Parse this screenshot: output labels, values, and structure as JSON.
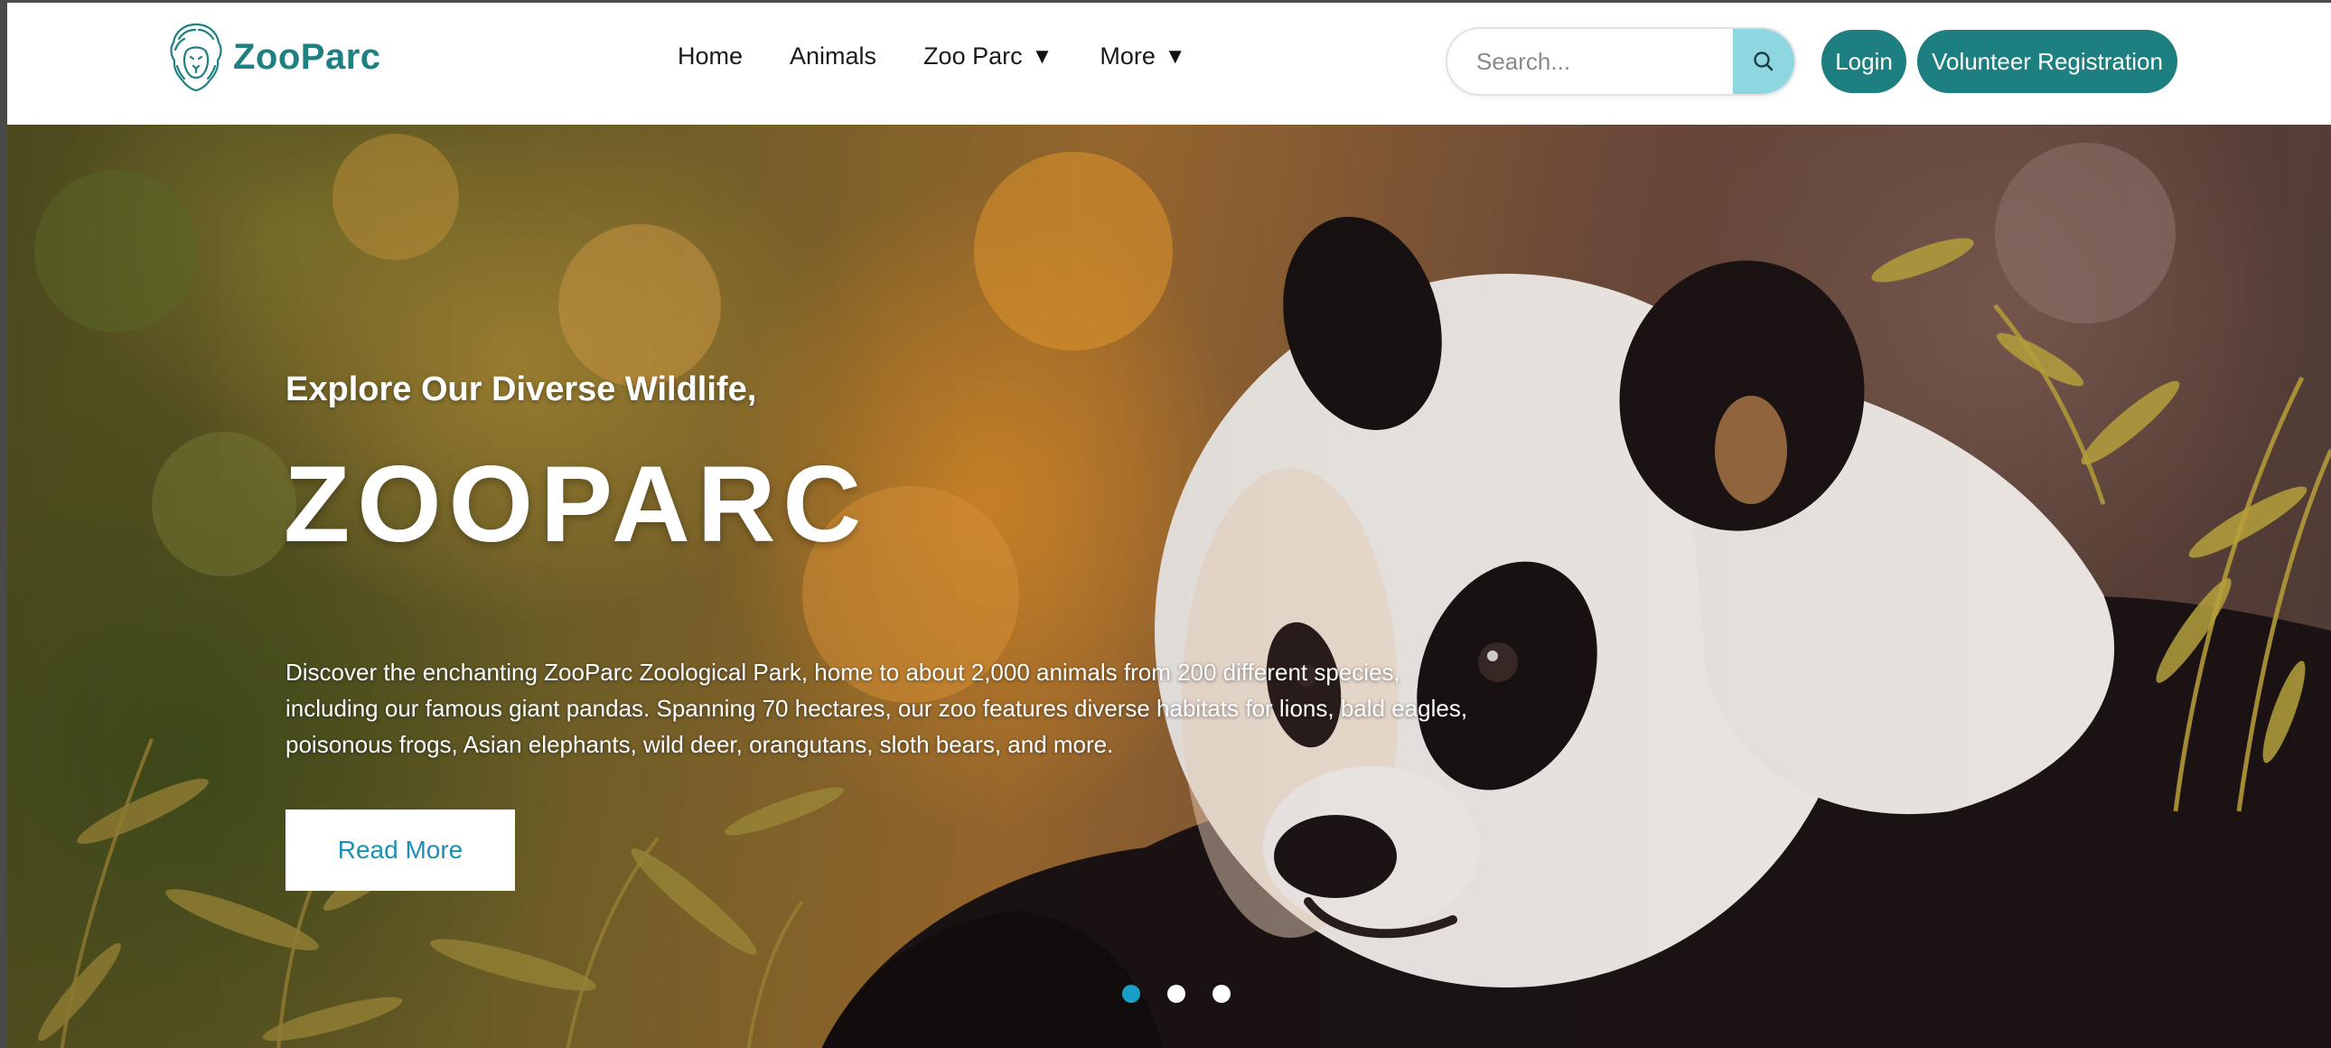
{
  "brand": {
    "name": "ZooParc",
    "logo_icon": "lion-head-icon",
    "color": "#1e8080"
  },
  "nav": {
    "items": [
      {
        "label": "Home",
        "dropdown": false
      },
      {
        "label": "Animals",
        "dropdown": false
      },
      {
        "label": "Zoo Parc",
        "dropdown": true
      },
      {
        "label": "More",
        "dropdown": true
      }
    ],
    "caret": "▼"
  },
  "search": {
    "placeholder": "Search...",
    "value": "",
    "button_icon": "search-icon",
    "button_color": "#8fd7e0"
  },
  "actions": {
    "login_label": "Login",
    "register_label": "Volunteer Registration",
    "button_color": "#1e7f80"
  },
  "hero": {
    "kicker": "Explore Our Diverse Wildlife,",
    "title": "ZOOPARC",
    "description": "Discover the enchanting ZooParc Zoological Park, home to about 2,000 animals from 200 different species, including our famous giant pandas. Spanning 70 hectares, our zoo features diverse habitats for lions, bald eagles, poisonous frogs, Asian elephants, wild deer, orangutans, sloth bears, and more.",
    "cta_label": "Read More",
    "cta_color": "#1c8fb5",
    "image_subject": "giant panda among bamboo",
    "slides": 3,
    "active_slide": 1,
    "active_dot_color": "#1a9fc7"
  }
}
